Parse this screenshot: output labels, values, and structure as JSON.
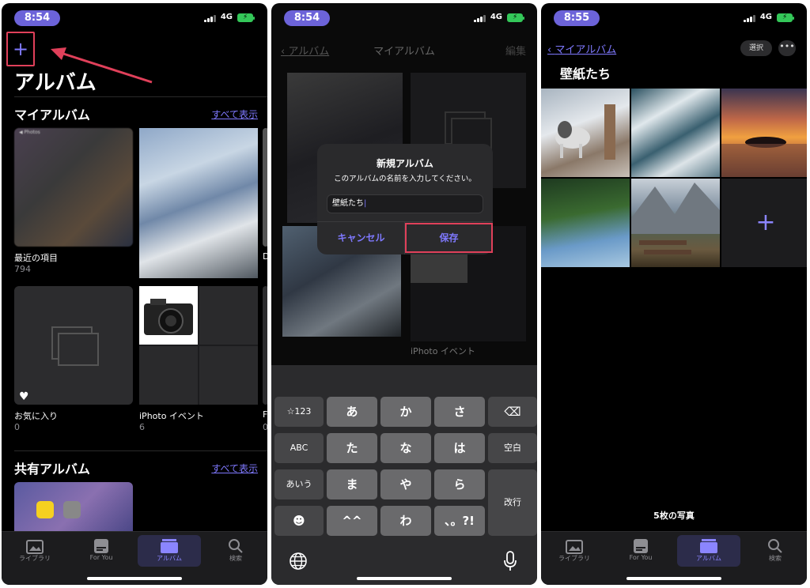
{
  "status": {
    "time1": "8:54",
    "time2": "8:54",
    "time3": "8:55",
    "network": "4G"
  },
  "panel1": {
    "title": "アルバム",
    "my_albums": {
      "heading": "マイアルバム",
      "see_all": "すべて表示",
      "albums": [
        {
          "name": "最近の項目",
          "count": "794"
        },
        {
          "name": "D",
          "count": ""
        },
        {
          "name": "お気に入り",
          "count": "0"
        },
        {
          "name": "iPhoto イベント",
          "count": "6"
        },
        {
          "name": "F",
          "count": "0"
        }
      ]
    },
    "shared": {
      "heading": "共有アルバム",
      "see_all": "すべて表示"
    }
  },
  "panel2": {
    "nav": {
      "back": "アルバム",
      "title": "マイアルバム",
      "edit": "編集"
    },
    "bg_album_label": "iPhoto イベント",
    "dialog": {
      "title": "新規アルバム",
      "message": "このアルバムの名前を入力してください。",
      "input_value": "壁紙たち",
      "cancel": "キャンセル",
      "save": "保存"
    },
    "keyboard": {
      "row1": [
        "☆123",
        "あ",
        "か",
        "さ",
        "⌫"
      ],
      "row2": [
        "ABC",
        "た",
        "な",
        "は",
        "空白"
      ],
      "row3": [
        "あいう",
        "ま",
        "や",
        "ら",
        "改行"
      ],
      "row4": [
        "☻",
        "^^",
        "わ",
        "、。?!"
      ]
    }
  },
  "panel3": {
    "nav": {
      "back": "マイアルバム",
      "select": "選択",
      "more": "•••"
    },
    "title": "壁紙たち",
    "photo_count": "5枚の写真",
    "add_symbol": "+"
  },
  "tabs": [
    {
      "label": "ライブラリ",
      "icon": "photo-library-icon"
    },
    {
      "label": "For You",
      "icon": "for-you-icon"
    },
    {
      "label": "アルバム",
      "icon": "albums-icon"
    },
    {
      "label": "検索",
      "icon": "search-icon"
    }
  ],
  "colors": {
    "accent": "#7f79ff",
    "highlight": "#e0405a",
    "time_pill": "#6c63d9"
  }
}
